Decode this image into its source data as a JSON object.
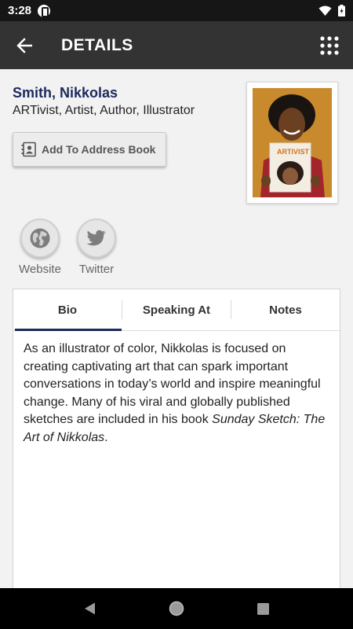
{
  "status_bar": {
    "time": "3:28",
    "icons": [
      "app-notification-icon",
      "wifi-icon",
      "battery-icon"
    ]
  },
  "app_bar": {
    "title": "DETAILS",
    "back_icon": "arrow-left-icon",
    "menu_icon": "grid-menu-icon"
  },
  "profile": {
    "name": "Smith, Nikkolas",
    "title": "ARTivist, Artist, Author, Illustrator",
    "address_book_label": "Add To Address Book",
    "photo_book_label": "ARTIVIST"
  },
  "social": [
    {
      "label": "Website",
      "icon": "globe-icon"
    },
    {
      "label": "Twitter",
      "icon": "twitter-bird-icon"
    }
  ],
  "tabs": [
    {
      "label": "Bio",
      "active": true
    },
    {
      "label": "Speaking At",
      "active": false
    },
    {
      "label": "Notes",
      "active": false
    }
  ],
  "bio": {
    "text": "As an illustrator of color, Nikkolas is focused on creating captivating art that can spark important conversations in today’s world and inspire meaningful change. Many of his viral and globally published sketches are included in his book ",
    "book_title": "Sunday Sketch: The Art of Nikkolas",
    "end": "."
  },
  "colors": {
    "accent": "#1c2a5c",
    "app_bar": "#333333",
    "status_bar": "#161616"
  }
}
